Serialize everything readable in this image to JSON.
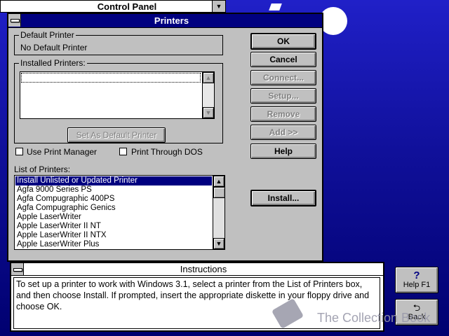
{
  "control_panel": {
    "title": "Control Panel"
  },
  "printers_dialog": {
    "title": "Printers",
    "default_printer": {
      "label": "Default Printer",
      "value": "No Default Printer"
    },
    "installed_printers": {
      "label": "Installed Printers:"
    },
    "set_default_label": "Set As Default Printer",
    "use_print_manager": "Use Print Manager",
    "print_through_dos": "Print Through DOS",
    "list_label": "List of Printers:",
    "printers_list": [
      "Install Unlisted or Updated Printer",
      "Agfa 9000 Series PS",
      "Agfa Compugraphic 400PS",
      "Agfa Compugraphic Genics",
      "Apple LaserWriter",
      "Apple LaserWriter II NT",
      "Apple LaserWriter II NTX",
      "Apple LaserWriter Plus"
    ],
    "buttons": {
      "ok": "OK",
      "cancel": "Cancel",
      "connect": "Connect...",
      "setup": "Setup...",
      "remove": "Remove",
      "add": "Add >>",
      "help": "Help",
      "install": "Install..."
    }
  },
  "instructions": {
    "title": "Instructions",
    "text": "To set up a printer to work with Windows 3.1, select a printer from the List of Printers box, and then choose Install. If prompted, insert the appropriate diskette in your floppy drive and choose OK."
  },
  "side_buttons": {
    "help": "Help  F1",
    "back": "Back"
  },
  "watermark": "The Collection Book"
}
